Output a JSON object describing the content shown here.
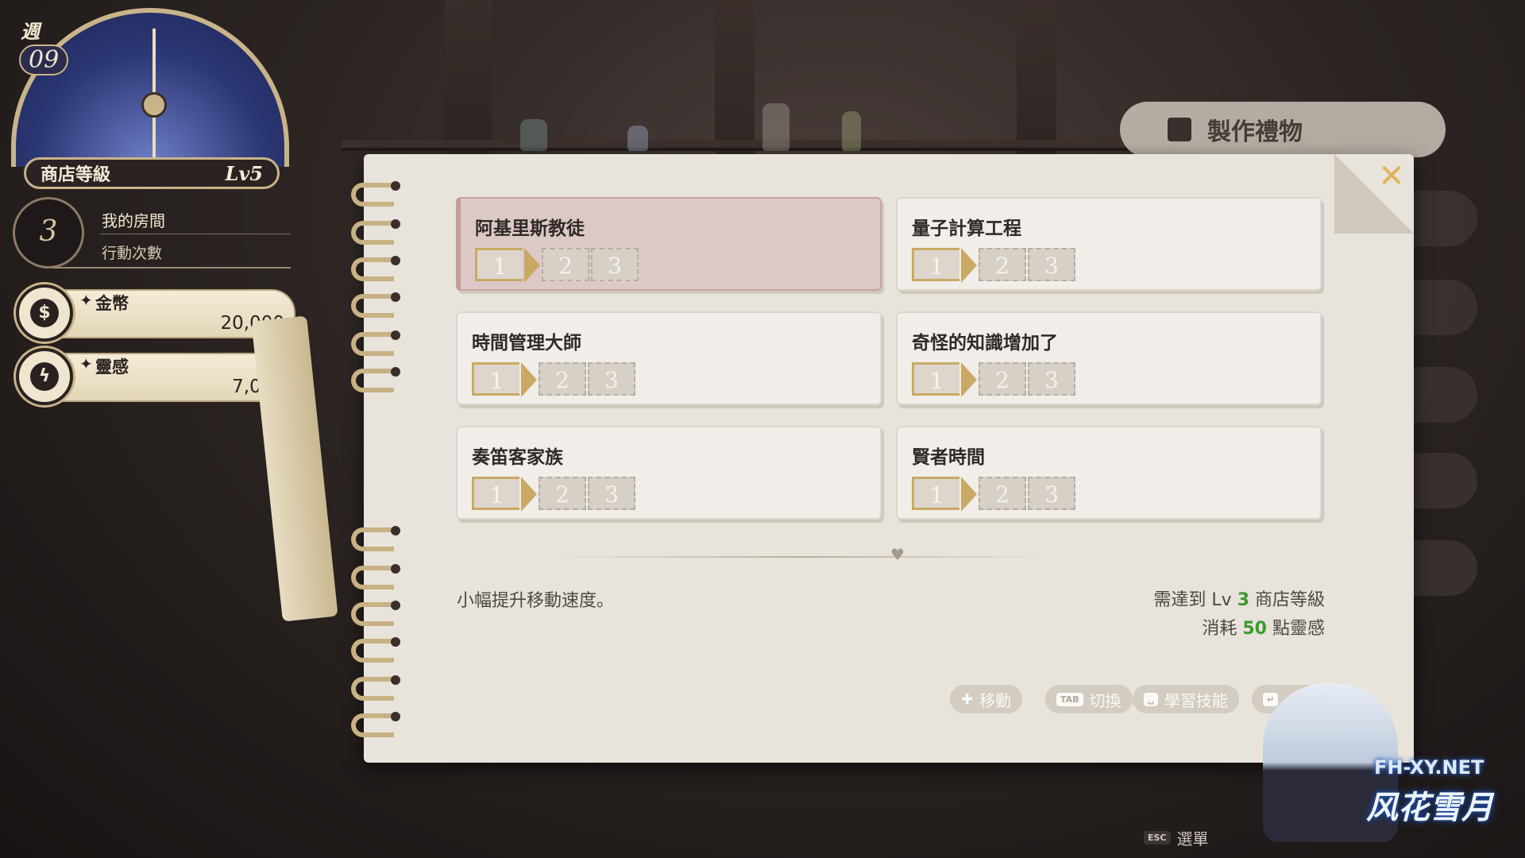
{
  "hud": {
    "week_label": "週",
    "week_number": "09",
    "shop_level_label": "商店等級",
    "shop_level_value": "Lv5",
    "action_count": "3",
    "room_label": "我的房間",
    "action_label": "行動次數",
    "gold_label": "金幣",
    "gold_value": "20,000",
    "inspiration_label": "靈感",
    "inspiration_value": "7,000"
  },
  "tabs": {
    "active_label": "製作禮物"
  },
  "skills": [
    {
      "name": "阿基里斯教徒",
      "steps": [
        "1",
        "2",
        "3"
      ],
      "selected": true
    },
    {
      "name": "量子計算工程",
      "steps": [
        "1",
        "2",
        "3"
      ],
      "selected": false
    },
    {
      "name": "時間管理大師",
      "steps": [
        "1",
        "2",
        "3"
      ],
      "selected": false
    },
    {
      "name": "奇怪的知識增加了",
      "steps": [
        "1",
        "2",
        "3"
      ],
      "selected": false
    },
    {
      "name": "奏笛客家族",
      "steps": [
        "1",
        "2",
        "3"
      ],
      "selected": false
    },
    {
      "name": "賢者時間",
      "steps": [
        "1",
        "2",
        "3"
      ],
      "selected": false
    }
  ],
  "detail": {
    "description": "小幅提升移動速度。",
    "req_prefix": "需達到 Lv ",
    "req_level": "3",
    "req_suffix": " 商店等級",
    "cost_prefix": "消耗 ",
    "cost_value": "50",
    "cost_suffix": " 點靈感"
  },
  "hints": {
    "move": "移動",
    "tab_key": "TAB",
    "switch": "切換",
    "learn": "學習技能"
  },
  "footer": {
    "esc_key": "ESC",
    "menu": "選單"
  },
  "watermark": {
    "url": "FH-XY.NET",
    "name": "风花雪月"
  },
  "colors": {
    "accent_gold": "#c9a964",
    "highlight_green": "#3a9b2f",
    "selected_card": "#dcc8c6",
    "close_icon": "#e2b25a"
  }
}
